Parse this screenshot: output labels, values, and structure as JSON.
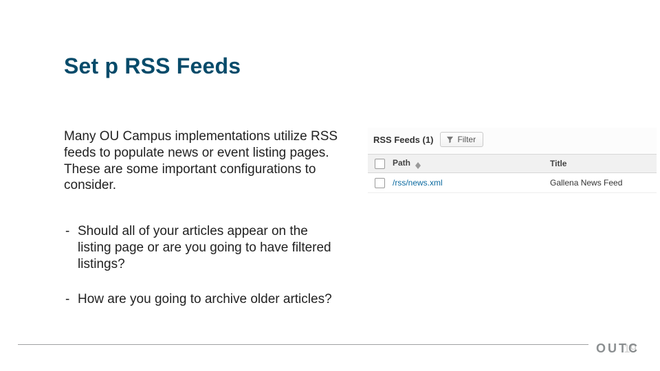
{
  "title": "Set p RSS Feeds",
  "intro": "Many OU Campus implementations utilize RSS feeds to populate news or event listing pages. These are some important configurations to consider.",
  "bullets": [
    "Should all of your articles appear on the listing page or are you going to have filtered listings?",
    "How are you going to archive older articles?"
  ],
  "rss": {
    "label": "RSS Feeds",
    "count": "(1)",
    "filter_label": "Filter",
    "columns": {
      "path": "Path",
      "title": "Title"
    },
    "row": {
      "path": "/rss/news.xml",
      "title": "Gallena News Feed"
    }
  },
  "footer": {
    "brand": "OUTC",
    "page": "19"
  }
}
